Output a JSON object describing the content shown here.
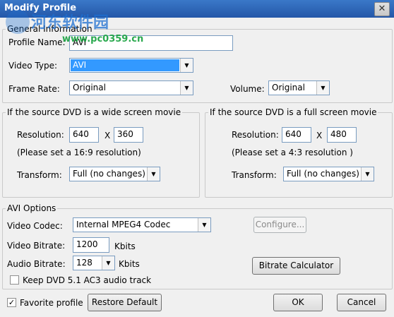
{
  "window": {
    "title": "Modify Profile",
    "close_glyph": "✕"
  },
  "watermark": {
    "chinese": "河东软件园",
    "url": "www.pc0359.cn"
  },
  "general": {
    "legend": "General Information",
    "profile_name_label": "Profile Name:",
    "profile_name_value": "AVI",
    "video_type_label": "Video Type:",
    "video_type_value": "AVI",
    "frame_rate_label": "Frame Rate:",
    "frame_rate_value": "Original",
    "volume_label": "Volume:",
    "volume_value": "Original"
  },
  "wide": {
    "legend": "If the source DVD is a wide screen movie",
    "resolution_label": "Resolution:",
    "width": "640",
    "x": "X",
    "height": "360",
    "hint": "(Please set a 16:9 resolution)",
    "transform_label": "Transform:",
    "transform_value": "Full (no changes)"
  },
  "full": {
    "legend": "If the source DVD is a full screen movie",
    "resolution_label": "Resolution:",
    "width": "640",
    "x": "X",
    "height": "480",
    "hint": "(Please set a 4:3 resolution )",
    "transform_label": "Transform:",
    "transform_value": "Full (no changes)"
  },
  "avi": {
    "legend": "AVI Options",
    "video_codec_label": "Video Codec:",
    "video_codec_value": "Internal MPEG4 Codec",
    "configure_button": "Configure...",
    "video_bitrate_label": "Video Bitrate:",
    "video_bitrate_value": "1200",
    "video_bitrate_unit": "Kbits",
    "audio_bitrate_label": "Audio Bitrate:",
    "audio_bitrate_value": "128",
    "audio_bitrate_unit": "Kbits",
    "bitrate_calculator_button": "Bitrate Calculator",
    "keep_ac3_label": "Keep DVD 5.1 AC3 audio track",
    "keep_ac3_checked": false
  },
  "footer": {
    "favorite_label": "Favorite profile",
    "favorite_checked": true,
    "restore_button": "Restore Default",
    "ok_button": "OK",
    "cancel_button": "Cancel"
  }
}
